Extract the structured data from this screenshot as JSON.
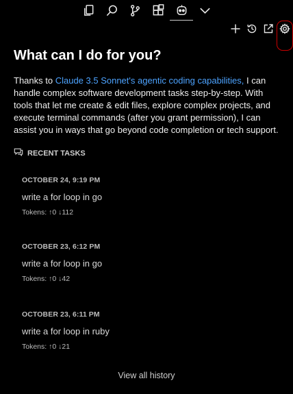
{
  "activity_bar": {
    "icons": [
      "explorer-icon",
      "search-icon",
      "source-control-icon",
      "extensions-icon",
      "cline-robot-icon",
      "chevron-down-icon"
    ],
    "active": "cline-robot-icon"
  },
  "toolbar": {
    "icons": [
      "plus-icon",
      "history-icon",
      "open-external-icon",
      "gear-icon"
    ]
  },
  "page": {
    "title": "What can I do for you?",
    "intro_prefix": "Thanks to ",
    "intro_link": "Claude 3.5 Sonnet's agentic coding capabilities,",
    "intro_suffix": " I can handle complex software development tasks step-by-step. With tools that let me create & edit files, explore complex projects, and execute terminal commands (after you grant permission), I can assist you in ways that go beyond code completion or tech support."
  },
  "recent": {
    "header": "RECENT TASKS",
    "tasks": [
      {
        "date": "OCTOBER 24, 9:19 PM",
        "text": "write a for loop in go",
        "tokens": "Tokens: ↑0 ↓112"
      },
      {
        "date": "OCTOBER 23, 6:12 PM",
        "text": "write a for loop in go",
        "tokens": "Tokens: ↑0 ↓42"
      },
      {
        "date": "OCTOBER 23, 6:11 PM",
        "text": "write a for loop in ruby",
        "tokens": "Tokens: ↑0 ↓21"
      }
    ],
    "view_all": "View all history"
  },
  "colors": {
    "background": "#000000",
    "link": "#4da3ff",
    "highlight_border": "#cc0000"
  }
}
